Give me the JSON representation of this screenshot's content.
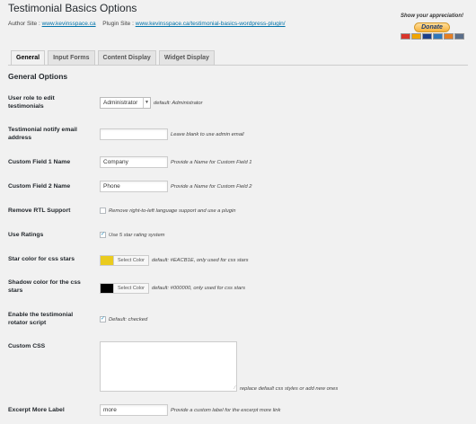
{
  "header": {
    "title": "Testimonial Basics Options",
    "author_site_label": "Author Site :",
    "author_site_link": "www.kevinsspace.ca",
    "plugin_site_label": "Plugin Site :",
    "plugin_site_link": "www.kevinsspace.ca/testimonial-basics-wordpress-plugin/"
  },
  "donate": {
    "caption": "Show your appreciation!",
    "button_label": "Donate",
    "cards": [
      "MC",
      "VISA",
      "AMEX",
      "DISC",
      "BANK"
    ]
  },
  "tabs": [
    {
      "label": "General",
      "active": true
    },
    {
      "label": "Input Forms",
      "active": false
    },
    {
      "label": "Content Display",
      "active": false
    },
    {
      "label": "Widget Display",
      "active": false
    }
  ],
  "section_title": "General Options",
  "fields": {
    "user_role": {
      "label": "User role to edit testimonials",
      "value": "Administrator",
      "desc": "default: Administrator"
    },
    "notify_email": {
      "label": "Testimonial notify email address",
      "value": "",
      "desc": "Leave blank to use admin email"
    },
    "custom_field_1": {
      "label": "Custom Field 1 Name",
      "value": "Company",
      "desc": "Provide a Name for Custom Field 1"
    },
    "custom_field_2": {
      "label": "Custom Field 2 Name",
      "value": "Phone",
      "desc": "Provide a Name for Custom Field 2"
    },
    "remove_rtl": {
      "label": "Remove RTL Support",
      "checked": false,
      "desc": "Remove right-to-left language support and use a plugin"
    },
    "use_ratings": {
      "label": "Use Ratings",
      "checked": true,
      "desc": "Use 5 star rating system"
    },
    "star_color": {
      "label": "Star color for css stars",
      "color": "#EACB1E",
      "button": "Select Color",
      "desc": "default: #EACB1E, only used for css stars"
    },
    "shadow_color": {
      "label": "Shadow color for the css stars",
      "color": "#000000",
      "button": "Select Color",
      "desc": "default: #000000, only used for css stars"
    },
    "rotator_script": {
      "label": "Enable the testimonial rotator script",
      "checked": true,
      "desc": "Default: checked"
    },
    "custom_css": {
      "label": "Custom CSS",
      "value": "",
      "desc": "replace default css styles or add new ones"
    },
    "excerpt_more": {
      "label": "Excerpt More Label",
      "value": "more",
      "desc": "Provide a custom label for the excerpt more link"
    }
  },
  "colors": {
    "star": "#EACB1E",
    "shadow": "#000000",
    "link": "#0073aa"
  }
}
